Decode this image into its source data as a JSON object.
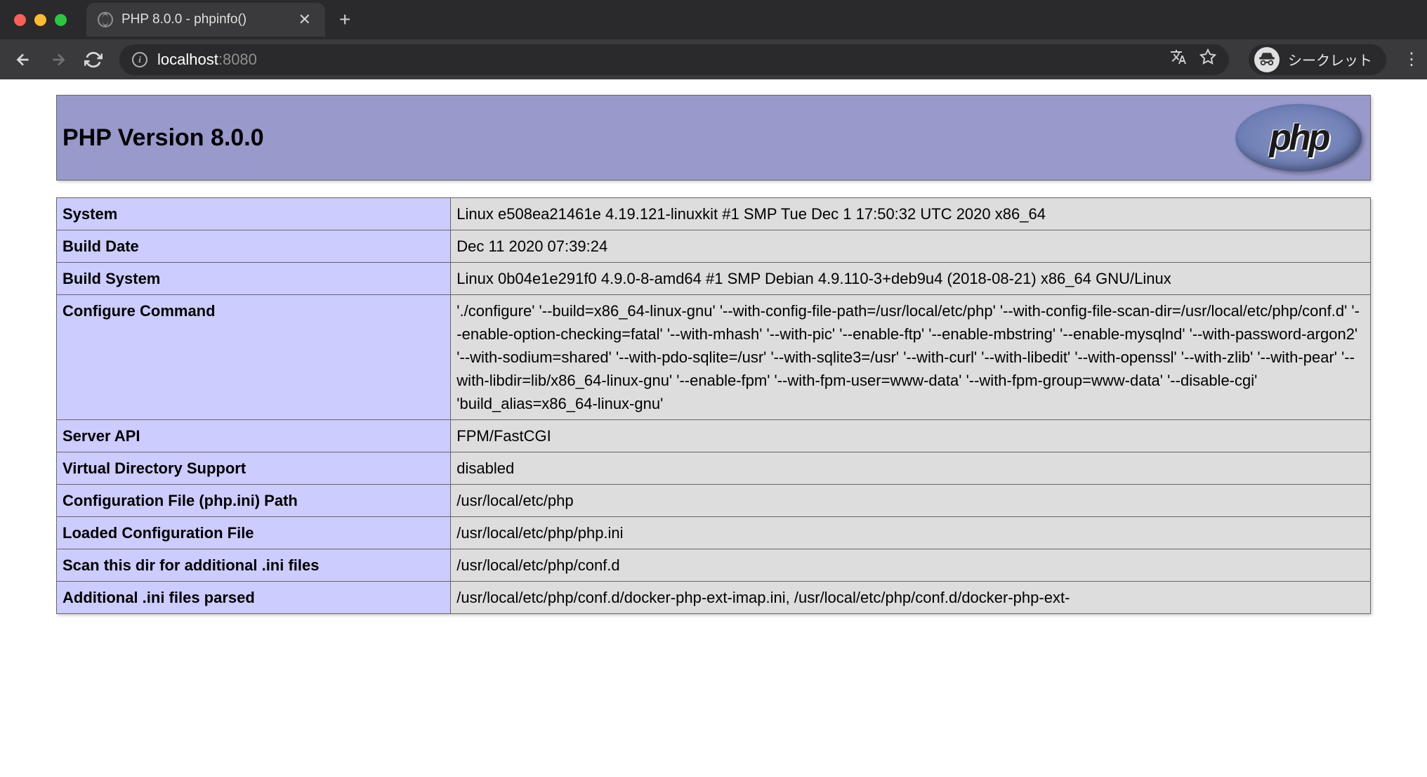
{
  "browser": {
    "tab_title": "PHP 8.0.0 - phpinfo()",
    "url_host": "localhost",
    "url_port": ":8080",
    "incognito_label": "シークレット"
  },
  "page": {
    "header_title": "PHP Version 8.0.0",
    "logo_text": "php",
    "rows": [
      {
        "key": "System",
        "val": "Linux e508ea21461e 4.19.121-linuxkit #1 SMP Tue Dec 1 17:50:32 UTC 2020 x86_64"
      },
      {
        "key": "Build Date",
        "val": "Dec 11 2020 07:39:24"
      },
      {
        "key": "Build System",
        "val": "Linux 0b04e1e291f0 4.9.0-8-amd64 #1 SMP Debian 4.9.110-3+deb9u4 (2018-08-21) x86_64 GNU/Linux"
      },
      {
        "key": "Configure Command",
        "val": "'./configure' '--build=x86_64-linux-gnu' '--with-config-file-path=/usr/local/etc/php' '--with-config-file-scan-dir=/usr/local/etc/php/conf.d' '--enable-option-checking=fatal' '--with-mhash' '--with-pic' '--enable-ftp' '--enable-mbstring' '--enable-mysqlnd' '--with-password-argon2' '--with-sodium=shared' '--with-pdo-sqlite=/usr' '--with-sqlite3=/usr' '--with-curl' '--with-libedit' '--with-openssl' '--with-zlib' '--with-pear' '--with-libdir=lib/x86_64-linux-gnu' '--enable-fpm' '--with-fpm-user=www-data' '--with-fpm-group=www-data' '--disable-cgi' 'build_alias=x86_64-linux-gnu'"
      },
      {
        "key": "Server API",
        "val": "FPM/FastCGI"
      },
      {
        "key": "Virtual Directory Support",
        "val": "disabled"
      },
      {
        "key": "Configuration File (php.ini) Path",
        "val": "/usr/local/etc/php"
      },
      {
        "key": "Loaded Configuration File",
        "val": "/usr/local/etc/php/php.ini"
      },
      {
        "key": "Scan this dir for additional .ini files",
        "val": "/usr/local/etc/php/conf.d"
      },
      {
        "key": "Additional .ini files parsed",
        "val": "/usr/local/etc/php/conf.d/docker-php-ext-imap.ini, /usr/local/etc/php/conf.d/docker-php-ext-"
      }
    ]
  }
}
